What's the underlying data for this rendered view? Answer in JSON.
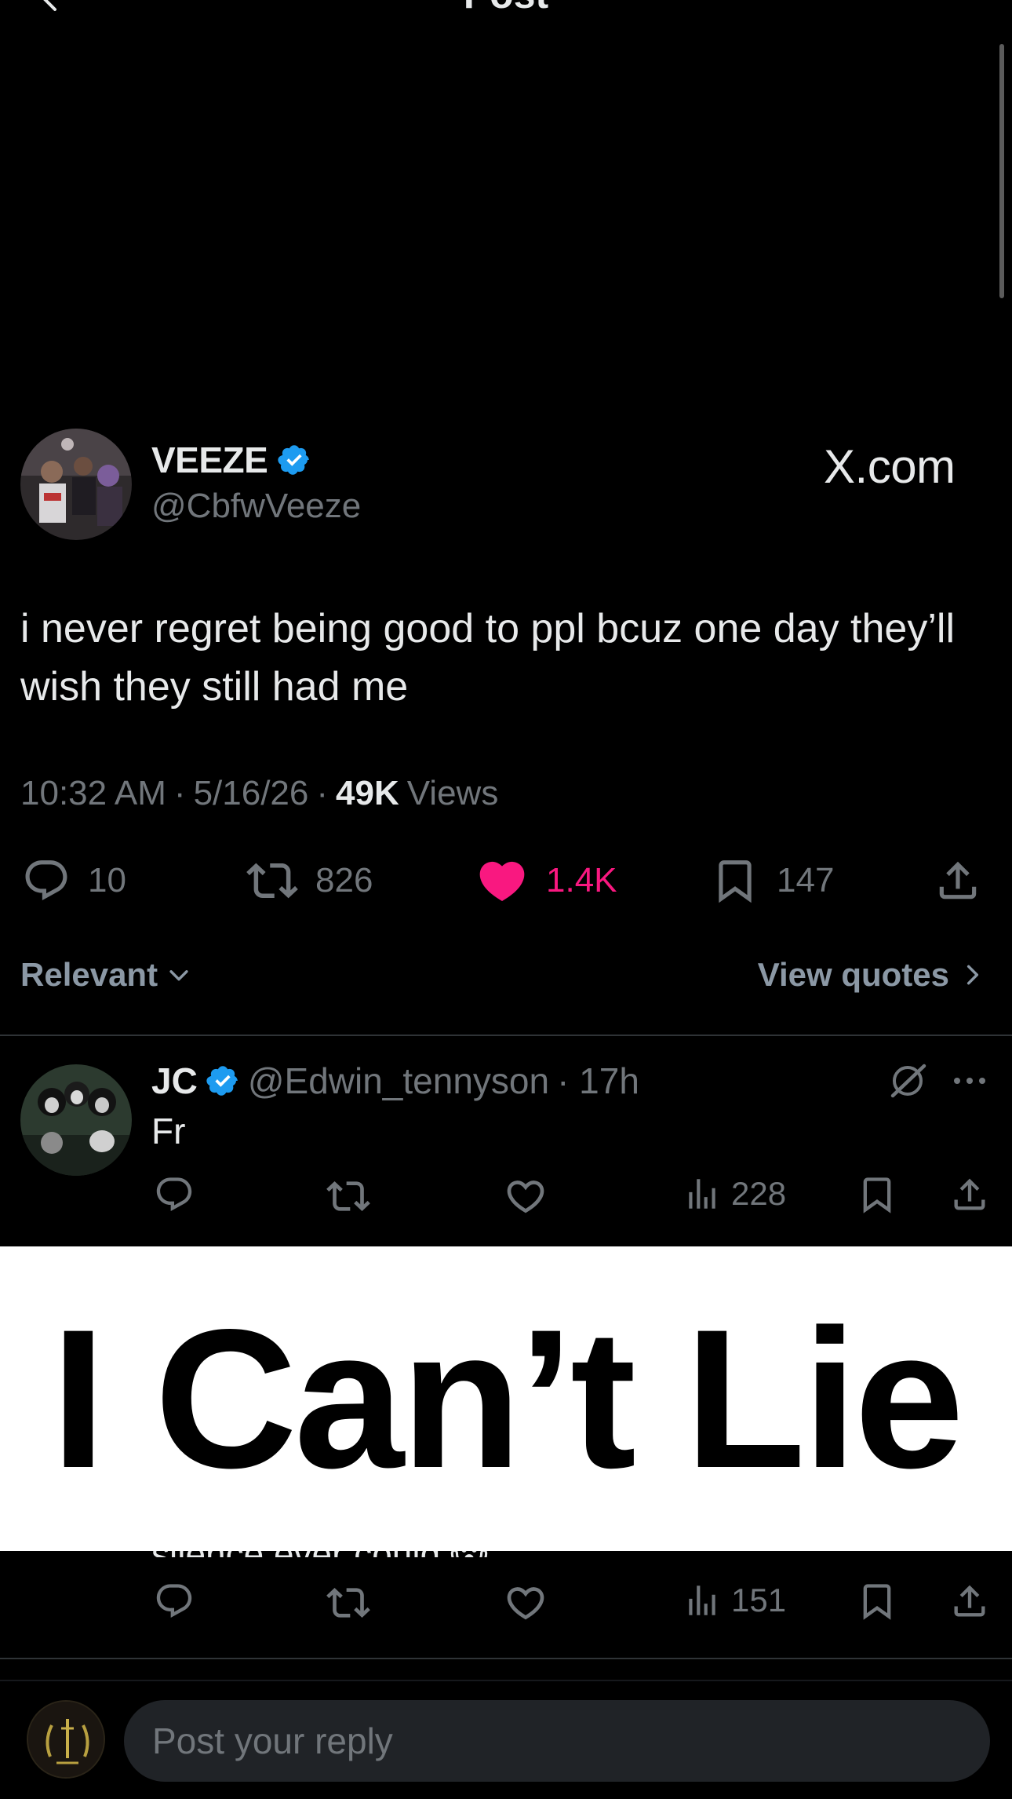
{
  "header": {
    "title": "Post"
  },
  "post": {
    "author_name": "VEEZE",
    "author_handle": "@CbfwVeeze",
    "watermark": "X.com",
    "text": "i never regret being good to ppl bcuz one day they’ll wish they still had me",
    "time": "10:32 AM",
    "date": "5/16/26",
    "sep": "·",
    "views_count": "49K",
    "views_label": "Views",
    "stats": {
      "replies": "10",
      "reposts": "826",
      "likes": "1.4K",
      "bookmarks": "147"
    },
    "colors": {
      "like": "#f91880",
      "verified": "#1d9bf0"
    }
  },
  "sort": {
    "label": "Relevant",
    "quotes_label": "View quotes"
  },
  "replies": [
    {
      "name": "JC",
      "handle": "@Edwin_tennyson",
      "time": "· 17h",
      "text": "Fr",
      "views": "228"
    },
    {
      "partial_text": "silence ever could 😱",
      "views": "151"
    }
  ],
  "overlay": {
    "text": "I Can’t Lie"
  },
  "composer": {
    "placeholder": "Post your reply"
  },
  "icons": [
    "back-icon",
    "verified-icon",
    "x-logo-icon",
    "reply-icon",
    "repost-icon",
    "heart-icon",
    "bookmark-icon",
    "share-icon",
    "chevron-down-icon",
    "chevron-right-icon",
    "grok-icon",
    "more-icon",
    "views-icon"
  ]
}
